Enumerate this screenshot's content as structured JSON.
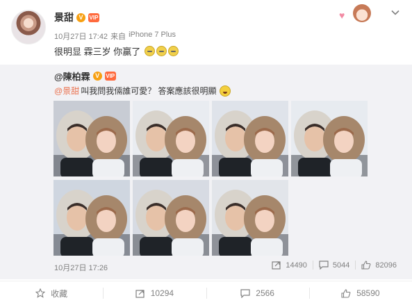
{
  "post": {
    "username": "景甜",
    "verified_mark": "V",
    "member_mark": "VIP",
    "date": "10月27日 17:42",
    "source_prefix": "来自",
    "device": "iPhone 7 Plus",
    "text": "很明显 霖三岁 你赢了"
  },
  "repost": {
    "username": "@陳柏霖",
    "verified_mark": "V",
    "member_mark": "VIP",
    "mention": "@景甜",
    "text": "叫我問我倆誰可愛？ 答案應該很明顯",
    "photo_count": 7,
    "time": "10月27日 17:26",
    "actions": {
      "repost_count": "14490",
      "comment_count": "5044",
      "like_count": "82096"
    }
  },
  "bottom_bar": {
    "favorite_label": "收藏",
    "repost_count": "10294",
    "comment_count": "2566",
    "like_count": "58590"
  },
  "colors": {
    "mention": "#eb7350",
    "verified": "#f7a012",
    "repost_bg": "#f2f2f5",
    "meta_text": "#808080"
  },
  "icons": [
    "chevron-down-icon",
    "verified-icon",
    "member-icon",
    "repost-icon",
    "comment-icon",
    "like-icon",
    "star-icon"
  ]
}
